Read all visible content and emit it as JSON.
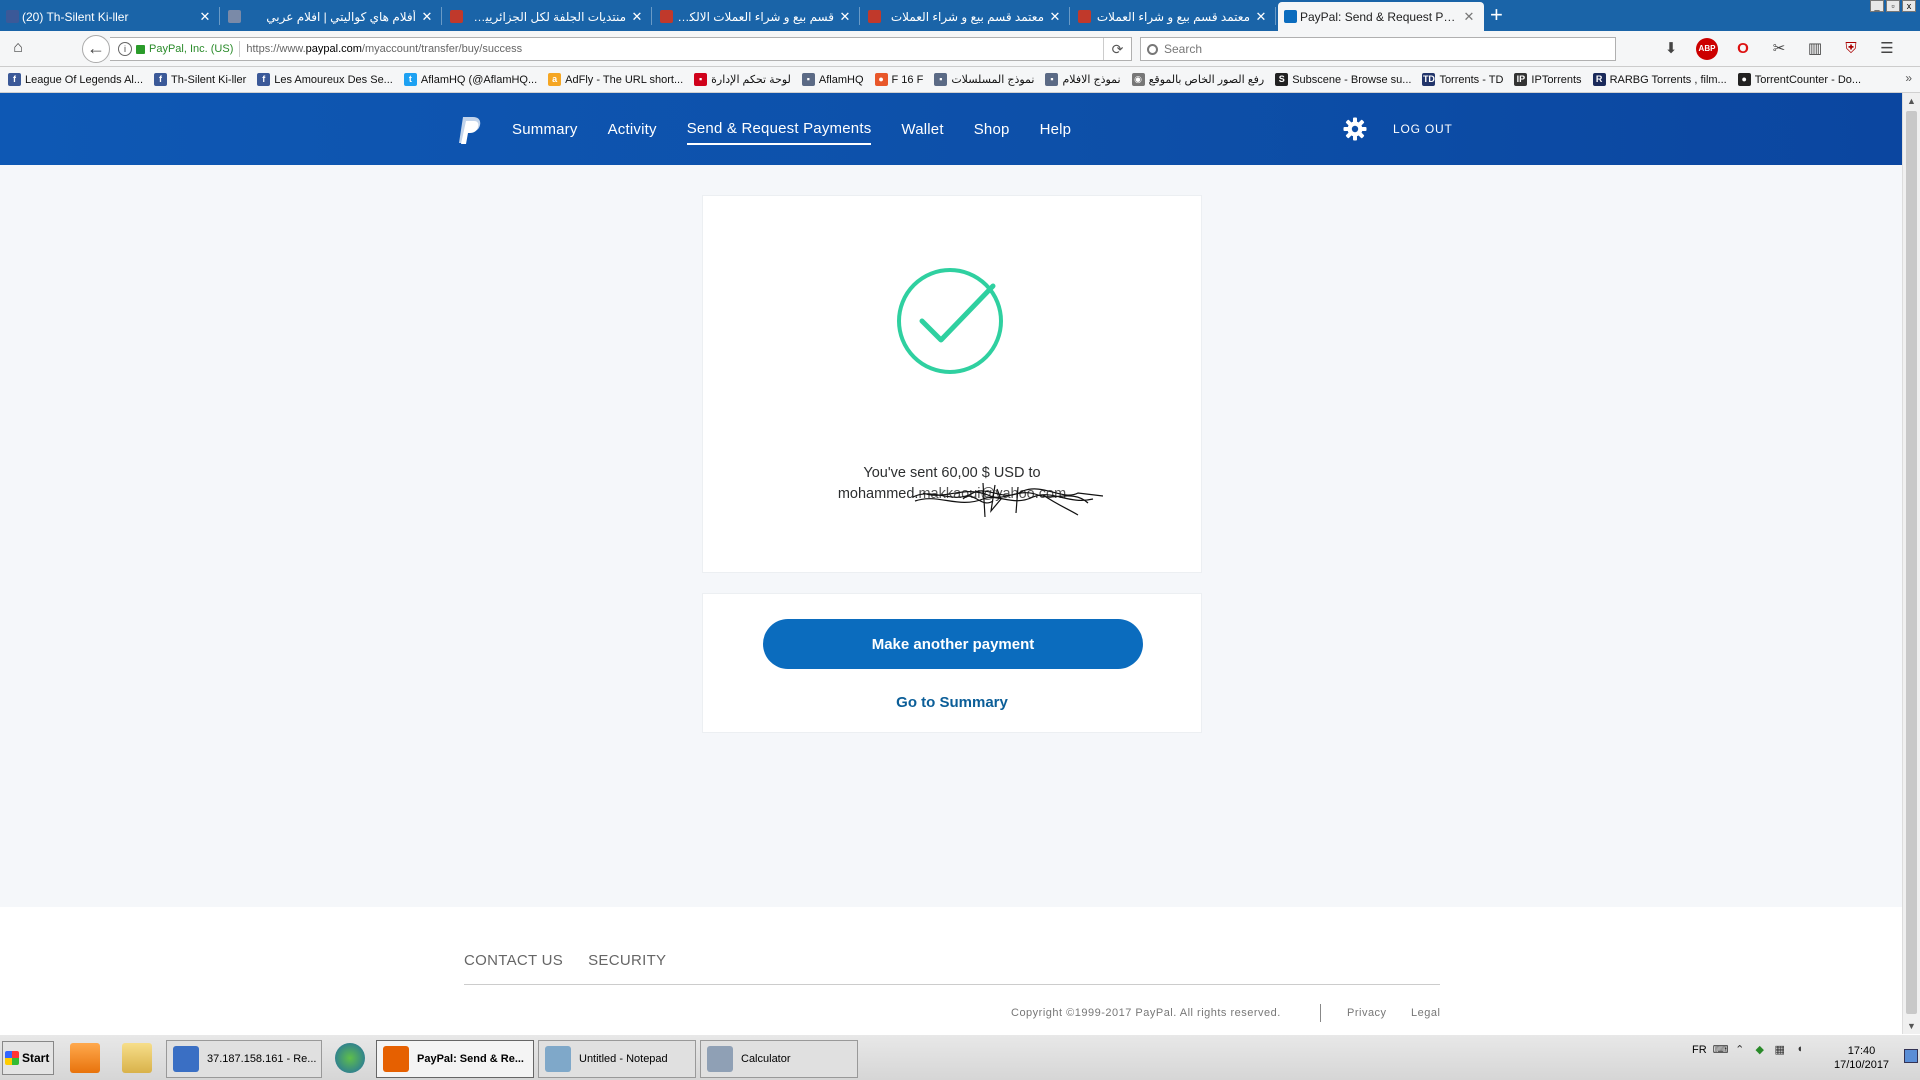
{
  "browser": {
    "tabs": [
      {
        "title": "(20) Th-Silent Ki-ller",
        "rtl": false,
        "icon": "facebook-icon",
        "color": "#3b5998"
      },
      {
        "title": "أفلام هاي كواليتي | افلام عربي",
        "rtl": true,
        "icon": "aflam-icon",
        "color": "#7a8aa8"
      },
      {
        "title": "منتديات الجلفة لكل الجزائريين و ا",
        "rtl": true,
        "icon": "forum-icon",
        "color": "#c0392b"
      },
      {
        "title": "قسم بيع و شراء العملات الالكترو",
        "rtl": true,
        "icon": "forum-icon",
        "color": "#c0392b"
      },
      {
        "title": "معتمد قسم بيع و شراء العملات",
        "rtl": true,
        "icon": "forum-icon",
        "color": "#c0392b"
      },
      {
        "title": "معتمد قسم بيع و شراء العملات",
        "rtl": true,
        "icon": "forum-icon",
        "color": "#c0392b"
      },
      {
        "title": "PayPal: Send & Request Payme",
        "rtl": false,
        "icon": "paypal-icon",
        "color": "#0b6cbe",
        "active": true
      }
    ],
    "new_tab": "+",
    "window_controls": [
      "_",
      "▫",
      "x"
    ],
    "identity": "PayPal, Inc. (US)",
    "url": {
      "prefix": "https://www.",
      "domain": "paypal.com",
      "path": "/myaccount/transfer/buy/success"
    },
    "search_placeholder": "Search",
    "bookmarks": [
      {
        "label": "League Of Legends Al...",
        "icon_char": "f",
        "color": "#3b5998"
      },
      {
        "label": "Th-Silent Ki-ller",
        "icon_char": "f",
        "color": "#3b5998"
      },
      {
        "label": "Les Amoureux Des Se...",
        "icon_char": "f",
        "color": "#3b5998"
      },
      {
        "label": "AflamHQ (@AflamHQ...",
        "icon_char": "t",
        "color": "#1da1f2"
      },
      {
        "label": "AdFly - The URL short...",
        "icon_char": "a",
        "color": "#f5a623"
      },
      {
        "label": "لوحة تحكم الإدارة",
        "icon_char": "▪",
        "color": "#d0021b"
      },
      {
        "label": "AflamHQ",
        "icon_char": "▪",
        "color": "#5b6a85"
      },
      {
        "label": "F 16 F",
        "icon_char": "●",
        "color": "#e8572a"
      },
      {
        "label": "نموذج المسلسلات",
        "icon_char": "▪",
        "color": "#5b6a85"
      },
      {
        "label": "نموذج الافلام",
        "icon_char": "▪",
        "color": "#5b6a85"
      },
      {
        "label": "رفع الصور الخاص بالموقع",
        "icon_char": "◉",
        "color": "#777777"
      },
      {
        "label": "Subscene - Browse su...",
        "icon_char": "S",
        "color": "#222222"
      },
      {
        "label": "Torrents - TD",
        "icon_char": "TD",
        "color": "#22356b"
      },
      {
        "label": "IPTorrents",
        "icon_char": "IP",
        "color": "#333333"
      },
      {
        "label": "RARBG Torrents , film...",
        "icon_char": "R",
        "color": "#1a2a5a"
      },
      {
        "label": "TorrentCounter - Do...",
        "icon_char": "●",
        "color": "#222222"
      }
    ],
    "bookmarks_more": "»"
  },
  "paypal": {
    "nav": [
      {
        "label": "Summary",
        "current": false
      },
      {
        "label": "Activity",
        "current": false
      },
      {
        "label": "Send & Request Payments",
        "current": true
      },
      {
        "label": "Wallet",
        "current": false
      },
      {
        "label": "Shop",
        "current": false
      },
      {
        "label": "Help",
        "current": false
      }
    ],
    "logout": "LOG OUT",
    "success": {
      "line1": "You've sent 60,00 $ USD to",
      "recipient_visible": "mohammed.",
      "recipient_obscured": "makkaoui@yahoo.com"
    },
    "primary_button": "Make another payment",
    "summary_link": "Go to Summary",
    "footer": {
      "contact": "CONTACT US",
      "security": "SECURITY",
      "copyright": "Copyright ©1999-2017 PayPal. All rights reserved.",
      "privacy": "Privacy",
      "legal": "Legal"
    },
    "colors": {
      "header": "#0d4fa8",
      "button": "#0b6cbe",
      "check": "#2fd0a0",
      "link": "#0b5e98"
    }
  },
  "taskbar": {
    "start_label": "Start",
    "tasks": [
      {
        "label": "37.187.158.161 - Re...",
        "icon": "remote-desktop-icon",
        "color": "#3a6fc4"
      },
      {
        "label": "PayPal: Send & Re...",
        "icon": "firefox-icon",
        "color": "#e66000",
        "active": true
      },
      {
        "label": "Untitled - Notepad",
        "icon": "notepad-icon",
        "color": "#7fa8c9"
      },
      {
        "label": "Calculator",
        "icon": "calculator-icon",
        "color": "#8fa0b5"
      }
    ],
    "lang": "FR",
    "time": "17:40",
    "date": "17/10/2017"
  }
}
